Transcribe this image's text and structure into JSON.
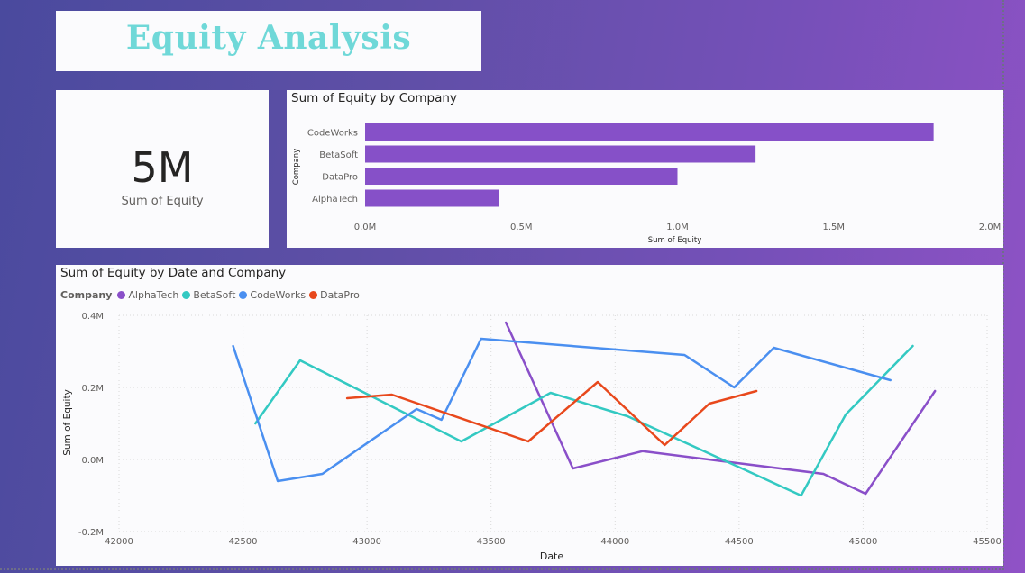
{
  "title": "Equity Analysis",
  "card": {
    "value": "5M",
    "label": "Sum of Equity"
  },
  "colors": {
    "accent": "#8650c8",
    "title": "#6fd8d8",
    "AlphaTech": "#8a4fc9",
    "BetaSoft": "#33c9c2",
    "CodeWorks": "#4a8ff0",
    "DataPro": "#e8481c"
  },
  "chart_data": [
    {
      "type": "bar",
      "orientation": "horizontal",
      "title": "Sum of Equity by Company",
      "xlabel": "Sum of Equity",
      "ylabel": "Company",
      "categories": [
        "CodeWorks",
        "BetaSoft",
        "DataPro",
        "AlphaTech"
      ],
      "values": [
        1.82,
        1.25,
        1.0,
        0.43
      ],
      "value_unit": "M",
      "xlim": [
        0,
        2.0
      ],
      "xticks": [
        "0.0M",
        "0.5M",
        "1.0M",
        "1.5M",
        "2.0M"
      ],
      "xtick_values": [
        0,
        0.5,
        1.0,
        1.5,
        2.0
      ],
      "grid": false
    },
    {
      "type": "line",
      "title": "Sum of Equity by Date and Company",
      "xlabel": "Date",
      "ylabel": "Sum of Equity",
      "legend_title": "Company",
      "legend_position": "top-left",
      "xlim": [
        42000,
        45500
      ],
      "ylim": [
        -0.2,
        0.4
      ],
      "value_unit": "M",
      "xticks": [
        "42000",
        "42500",
        "43000",
        "43500",
        "44000",
        "44500",
        "45000",
        "45500"
      ],
      "xtick_values": [
        42000,
        42500,
        43000,
        43500,
        44000,
        44500,
        45000,
        45500
      ],
      "yticks": [
        "-0.2M",
        "0.0M",
        "0.2M",
        "0.4M"
      ],
      "ytick_values": [
        -0.2,
        0.0,
        0.2,
        0.4
      ],
      "grid": true,
      "series": [
        {
          "name": "AlphaTech",
          "x": [
            43560,
            43830,
            44110,
            44840,
            45010,
            45290
          ],
          "y": [
            0.38,
            -0.025,
            0.023,
            -0.04,
            -0.095,
            0.19
          ]
        },
        {
          "name": "BetaSoft",
          "x": [
            42550,
            42730,
            43380,
            43740,
            44050,
            44750,
            44930,
            45200
          ],
          "y": [
            0.1,
            0.275,
            0.05,
            0.185,
            0.12,
            -0.1,
            0.125,
            0.315
          ]
        },
        {
          "name": "CodeWorks",
          "x": [
            42460,
            42640,
            42820,
            43200,
            43300,
            43460,
            44280,
            44480,
            44640,
            45110
          ],
          "y": [
            0.315,
            -0.06,
            -0.04,
            0.14,
            0.11,
            0.335,
            0.29,
            0.2,
            0.31,
            0.22
          ]
        },
        {
          "name": "DataPro",
          "x": [
            42920,
            43100,
            43650,
            43930,
            44200,
            44380,
            44570
          ],
          "y": [
            0.17,
            0.18,
            0.05,
            0.215,
            0.04,
            0.155,
            0.19
          ]
        }
      ]
    }
  ]
}
